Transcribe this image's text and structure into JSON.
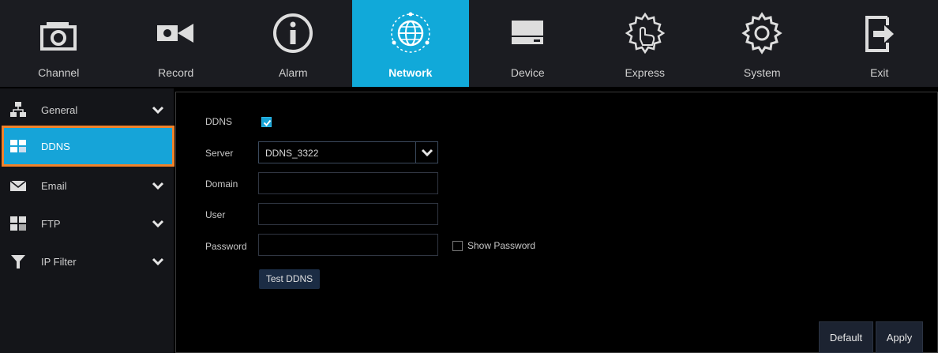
{
  "top_menu": {
    "tabs": [
      {
        "label": "Channel",
        "icon": "camera-icon"
      },
      {
        "label": "Record",
        "icon": "video-record-icon"
      },
      {
        "label": "Alarm",
        "icon": "info-icon"
      },
      {
        "label": "Network",
        "icon": "globe-network-icon",
        "active": true
      },
      {
        "label": "Device",
        "icon": "hard-drive-icon"
      },
      {
        "label": "Express",
        "icon": "gear-hand-icon"
      },
      {
        "label": "System",
        "icon": "gear-icon"
      },
      {
        "label": "Exit",
        "icon": "exit-icon"
      }
    ],
    "active_color": "#11a9d9"
  },
  "sidebar": {
    "items": [
      {
        "label": "General",
        "icon": "network-hierarchy-icon",
        "expandable": true
      },
      {
        "label": "DDNS",
        "icon": "ddns-icon",
        "selected": true
      },
      {
        "label": "Email",
        "icon": "envelope-icon",
        "expandable": true
      },
      {
        "label": "FTP",
        "icon": "ftp-icon",
        "expandable": true
      },
      {
        "label": "IP Filter",
        "icon": "funnel-icon",
        "expandable": true
      }
    ],
    "highlight_color": "#f0822a"
  },
  "form": {
    "ddns_label": "DDNS",
    "ddns_enabled": true,
    "server_label": "Server",
    "server_value": "DDNS_3322",
    "domain_label": "Domain",
    "domain_value": "",
    "user_label": "User",
    "user_value": "",
    "password_label": "Password",
    "password_value": "",
    "show_password_label": "Show Password",
    "show_password_checked": false,
    "test_button": "Test DDNS"
  },
  "footer": {
    "default_button": "Default",
    "apply_button": "Apply"
  }
}
